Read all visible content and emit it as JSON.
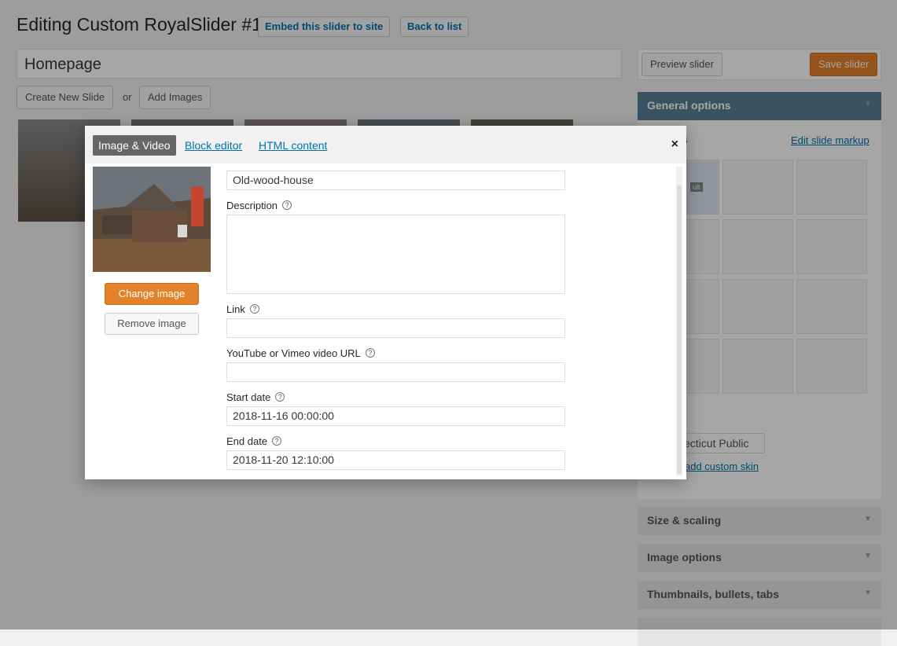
{
  "page": {
    "title": "Editing Custom RoyalSlider #1",
    "embed_link": "Embed this slider to site",
    "back_link": "Back to list",
    "slider_name": "Homepage",
    "create_slide": "Create New Slide",
    "or": "or",
    "add_images": "Add Images"
  },
  "sidebar": {
    "preview_button": "Preview slider",
    "save_button": "Save slider",
    "general_options": "General options",
    "edit_markup_link": "Edit slide markup",
    "templates_label_partial": "es",
    "skin_select_partial": "ecticut Public",
    "add_skin_partial": "add custom skin",
    "layout_default_label": "ult",
    "sections": [
      "Size & scaling",
      "Image options",
      "Thumbnails, bullets, tabs"
    ]
  },
  "modal": {
    "tabs": {
      "image_video": "Image & Video",
      "block_editor": "Block editor",
      "html_content": "HTML content"
    },
    "close": "×",
    "change_image": "Change image",
    "remove_image": "Remove image",
    "title_value": "Old-wood-house",
    "description_label": "Description",
    "description_value": "",
    "link_label": "Link",
    "link_value": "",
    "video_label": "YouTube or Vimeo video URL",
    "video_value": "",
    "start_label": "Start date",
    "start_value": "2018-11-16 00:00:00",
    "end_label": "End date",
    "end_value": "2018-11-20 12:10:00"
  },
  "colors": {
    "accent_orange": "#e3822b",
    "link_blue": "#0073aa",
    "general_header": "#5b7e96"
  }
}
